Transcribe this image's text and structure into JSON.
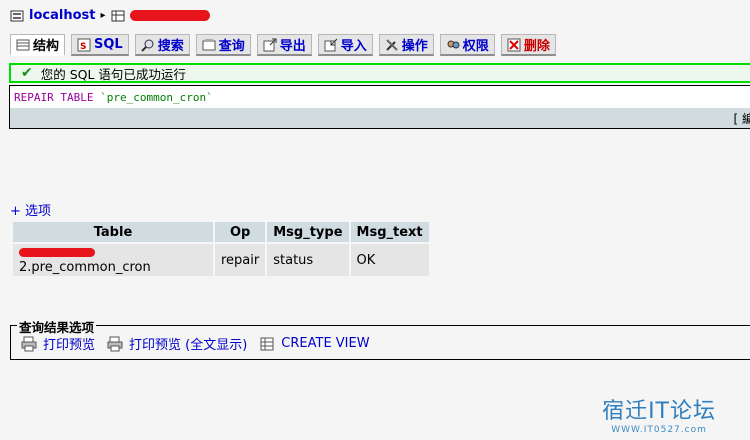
{
  "breadcrumb": {
    "host": "localhost",
    "separator": "▸"
  },
  "tabs": [
    {
      "label": "结构",
      "icon": "structure-icon"
    },
    {
      "label": "SQL",
      "icon": "sql-icon"
    },
    {
      "label": "搜索",
      "icon": "search-icon"
    },
    {
      "label": "查询",
      "icon": "query-icon"
    },
    {
      "label": "导出",
      "icon": "export-icon"
    },
    {
      "label": "导入",
      "icon": "import-icon"
    },
    {
      "label": "操作",
      "icon": "operations-icon"
    },
    {
      "label": "权限",
      "icon": "privileges-icon"
    },
    {
      "label": "删除",
      "icon": "drop-icon"
    }
  ],
  "message": {
    "text": "您的 SQL 语句已成功运行",
    "icon": "checkmark-icon"
  },
  "sql": {
    "keyword": "REPAIR TABLE",
    "table": "`pre_common_cron`",
    "edge_text": "[ 編"
  },
  "options_label": "+ 选项",
  "results": {
    "columns": [
      "Table",
      "Op",
      "Msg_type",
      "Msg_text"
    ],
    "rows": [
      {
        "table": "2.pre_common_cron",
        "op": "repair",
        "msg_type": "status",
        "msg_text": "OK"
      }
    ]
  },
  "query_options": {
    "legend": "查询结果选项",
    "print_view": "打印预览",
    "print_view_full": "打印预览 (全文显示)",
    "create_view": "CREATE VIEW"
  },
  "watermark": {
    "main": "宿迁IT论坛",
    "sub": "WWW.IT0527.com"
  },
  "colors": {
    "link": "#0000cc",
    "header_bg": "#d0dce0",
    "success_border": "#00dd00",
    "redaction": "#e8141b"
  }
}
